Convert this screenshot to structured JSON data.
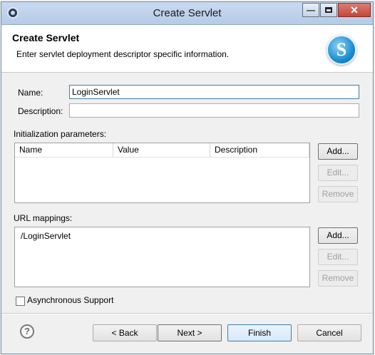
{
  "window": {
    "title": "Create Servlet",
    "close_glyph": "✕",
    "min_glyph": "—"
  },
  "header": {
    "title": "Create Servlet",
    "description": "Enter servlet deployment descriptor specific information.",
    "logo_letter": "S"
  },
  "form": {
    "name_label": "Name:",
    "name_value": "LoginServlet",
    "description_label": "Description:",
    "description_value": ""
  },
  "init_params": {
    "label": "Initialization parameters:",
    "columns": [
      "Name",
      "Value",
      "Description"
    ],
    "add_label": "Add...",
    "edit_label": "Edit...",
    "remove_label": "Remove"
  },
  "url_mappings": {
    "label": "URL mappings:",
    "items": [
      "/LoginServlet"
    ],
    "add_label": "Add...",
    "edit_label": "Edit...",
    "remove_label": "Remove"
  },
  "async": {
    "label": "Asynchronous Support",
    "checked": false
  },
  "footer": {
    "help_glyph": "?",
    "back_label": "< Back",
    "next_label": "Next >",
    "finish_label": "Finish",
    "cancel_label": "Cancel"
  },
  "colors": {
    "titlebar": "#c9daf0",
    "close_button": "#c3463a",
    "focus_border": "#3c7fb1",
    "logo_blue": "#1b8fd3"
  }
}
